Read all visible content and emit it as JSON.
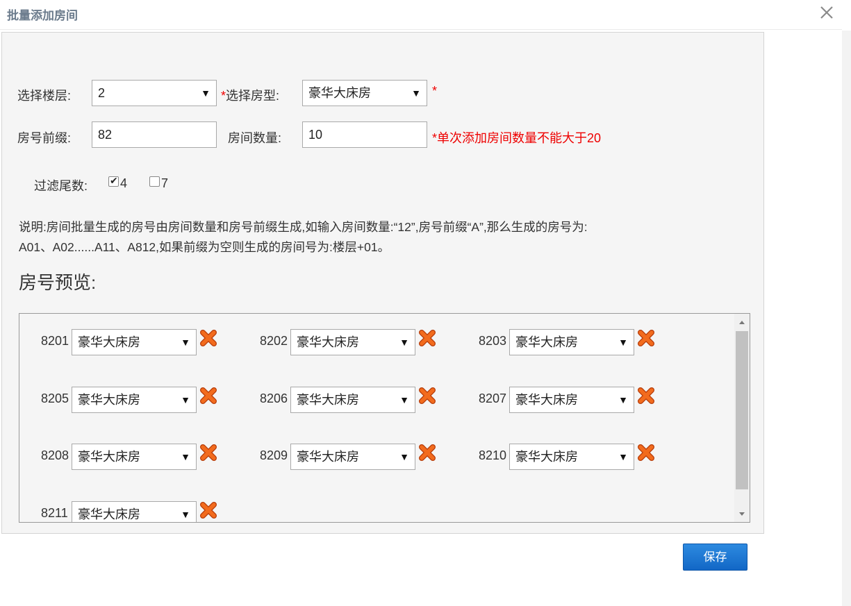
{
  "dialog": {
    "title": "批量添加房间"
  },
  "form": {
    "floor_label": "选择楼层:",
    "floor_value": "2",
    "room_type_required_mark": "*",
    "room_type_label": "选择房型:",
    "room_type_value": "豪华大床房",
    "room_type_after_mark": "*",
    "prefix_label": "房号前缀:",
    "prefix_value": "82",
    "count_label": "房间数量:",
    "count_value": "10",
    "count_hint": "*单次添加房间数量不能大于20",
    "filter_label": "过滤尾数:",
    "filter_options": [
      {
        "label": "4",
        "checked": true
      },
      {
        "label": "7",
        "checked": false
      }
    ]
  },
  "description": {
    "line1": "说明:房间批量生成的房号由房间数量和房号前缀生成,如输入房间数量:“12”,房号前缀“A”,那么生成的房号为:",
    "line2": "A01、A02......A11、A812,如果前缀为空则生成的房间号为:楼层+01。"
  },
  "preview": {
    "title": "房号预览:",
    "rooms": [
      {
        "number": "8201",
        "type": "豪华大床房"
      },
      {
        "number": "8202",
        "type": "豪华大床房"
      },
      {
        "number": "8203",
        "type": "豪华大床房"
      },
      {
        "number": "8205",
        "type": "豪华大床房"
      },
      {
        "number": "8206",
        "type": "豪华大床房"
      },
      {
        "number": "8207",
        "type": "豪华大床房"
      },
      {
        "number": "8208",
        "type": "豪华大床房"
      },
      {
        "number": "8209",
        "type": "豪华大床房"
      },
      {
        "number": "8210",
        "type": "豪华大床房"
      },
      {
        "number": "8211",
        "type": "豪华大床房"
      }
    ]
  },
  "actions": {
    "save_label": "保存"
  },
  "icons": {
    "close": "close-icon",
    "delete": "delete-x-icon",
    "dropdown": "chevron-down-icon"
  },
  "colors": {
    "required": "#e00000",
    "primary_button": "#1a74d4",
    "delete_icon": "#f26b1d"
  }
}
